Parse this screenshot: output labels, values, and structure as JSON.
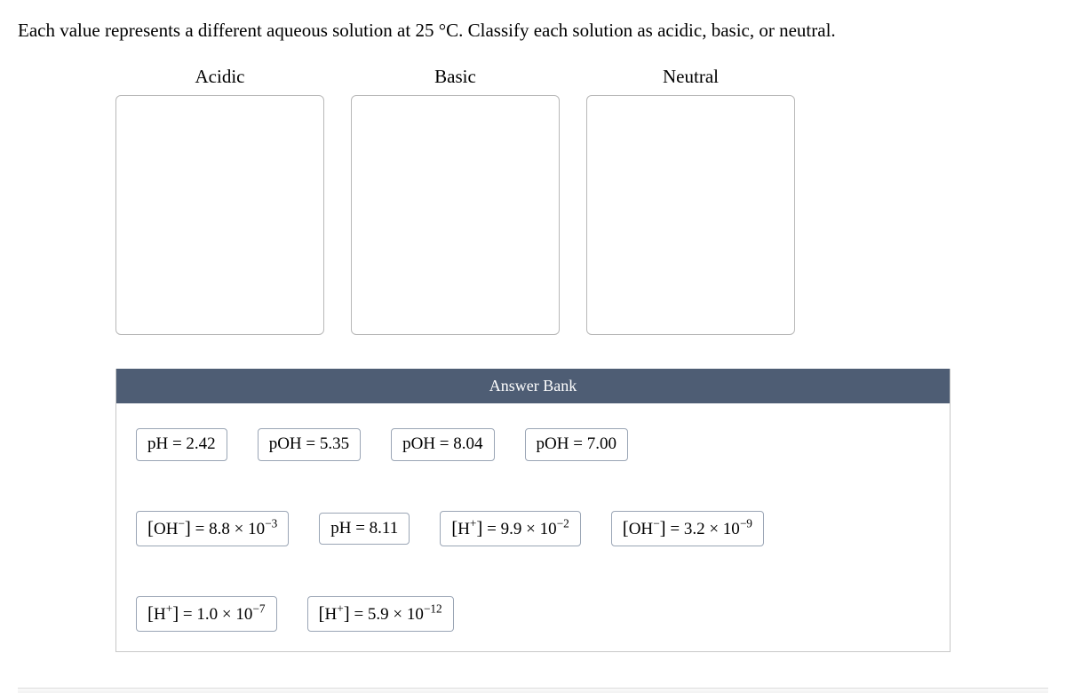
{
  "question": "Each value represents a different aqueous solution at 25 °C. Classify each solution as acidic, basic, or neutral.",
  "categories": {
    "acidic": "Acidic",
    "basic": "Basic",
    "neutral": "Neutral"
  },
  "bank_header": "Answer Bank",
  "tiles": {
    "t1": {
      "text": "pH = 2.42",
      "html": "pH = 2.42"
    },
    "t2": {
      "text": "pOH = 5.35",
      "html": "pOH = 5.35"
    },
    "t3": {
      "text": "pOH = 8.04",
      "html": "pOH = 8.04"
    },
    "t4": {
      "text": "pOH = 7.00",
      "html": "pOH = 7.00"
    },
    "t5": {
      "text": "[OH−] = 8.8 × 10−3",
      "html": "<span class='br'>[</span>OH<sup>−</sup><span class='br'>]</span> = 8.8 × 10<sup>−3</sup>"
    },
    "t6": {
      "text": "pH = 8.11",
      "html": "pH = 8.11"
    },
    "t7": {
      "text": "[H+] = 9.9 × 10−2",
      "html": "<span class='br'>[</span>H<sup>+</sup><span class='br'>]</span> = 9.9 × 10<sup>−2</sup>"
    },
    "t8": {
      "text": "[OH−] = 3.2 × 10−9",
      "html": "<span class='br'>[</span>OH<sup>−</sup><span class='br'>]</span> = 3.2 × 10<sup>−9</sup>"
    },
    "t9": {
      "text": "[H+] = 1.0 × 10−7",
      "html": "<span class='br'>[</span>H<sup>+</sup><span class='br'>]</span> = 1.0 × 10<sup>−7</sup>"
    },
    "t10": {
      "text": "[H+] = 5.9 × 10−12",
      "html": "<span class='br'>[</span>H<sup>+</sup><span class='br'>]</span> = 5.9 × 10<sup>−12</sup>"
    }
  }
}
